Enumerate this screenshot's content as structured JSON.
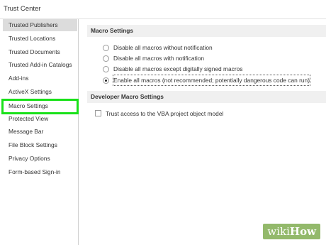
{
  "window": {
    "title": "Trust Center"
  },
  "sidebar": {
    "items": [
      {
        "label": "Trusted Publishers",
        "active": true
      },
      {
        "label": "Trusted Locations"
      },
      {
        "label": "Trusted Documents"
      },
      {
        "label": "Trusted Add-in Catalogs"
      },
      {
        "label": "Add-ins"
      },
      {
        "label": "ActiveX Settings"
      },
      {
        "label": "Macro Settings",
        "highlighted": true
      },
      {
        "label": "Protected View"
      },
      {
        "label": "Message Bar"
      },
      {
        "label": "File Block Settings"
      },
      {
        "label": "Privacy Options"
      },
      {
        "label": "Form-based Sign-in"
      }
    ]
  },
  "macro_settings": {
    "header": "Macro Settings",
    "options": [
      {
        "label": "Disable all macros without notification",
        "selected": false
      },
      {
        "label": "Disable all macros with notification",
        "selected": false
      },
      {
        "label": "Disable all macros except digitally signed macros",
        "selected": false
      },
      {
        "label": "Enable all macros (not recommended; potentially dangerous code can run)",
        "selected": true
      }
    ]
  },
  "developer_settings": {
    "header": "Developer Macro Settings",
    "vba_access_label": "Trust access to the VBA project object model",
    "vba_access_checked": false
  },
  "watermark": {
    "wiki": "wiki",
    "how": "How"
  },
  "colors": {
    "highlight": "#19e119",
    "active_item": "#dcdcdc",
    "watermark_bg": "#93b96b"
  }
}
